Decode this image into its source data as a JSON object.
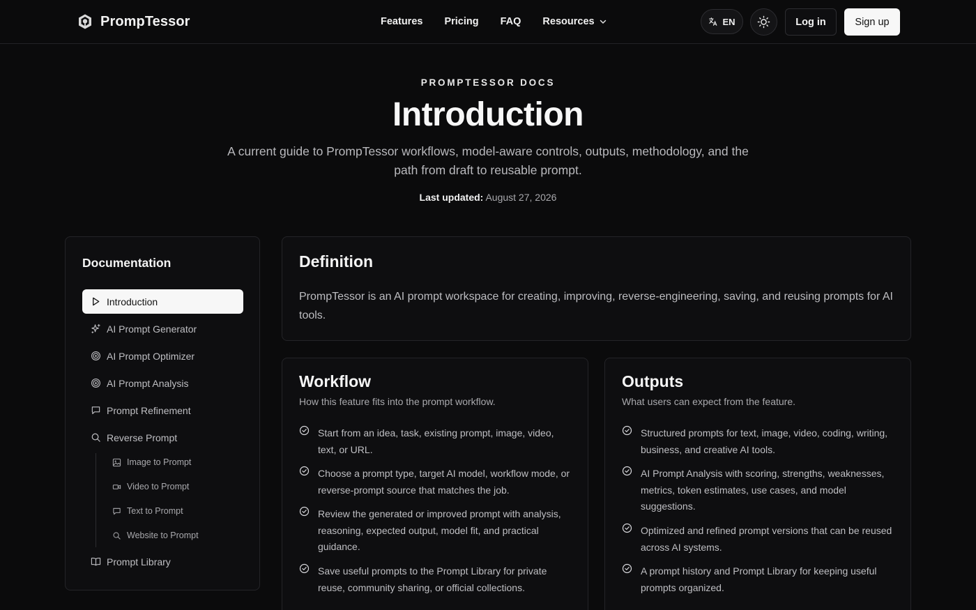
{
  "header": {
    "brand": "PrompTessor",
    "nav": [
      {
        "label": "Features"
      },
      {
        "label": "Pricing"
      },
      {
        "label": "FAQ"
      },
      {
        "label": "Resources"
      }
    ],
    "lang_label": "EN",
    "login_label": "Log in",
    "signup_label": "Sign up"
  },
  "hero": {
    "eyebrow": "PROMPTESSOR DOCS",
    "title": "Introduction",
    "subtitle": "A current guide to PrompTessor workflows, model-aware controls, outputs, methodology, and the path from draft to reusable prompt.",
    "updated_label": "Last updated:",
    "updated_date": "August 27, 2026"
  },
  "sidebar": {
    "title": "Documentation",
    "items": [
      {
        "label": "Introduction",
        "icon": "play-icon",
        "active": true
      },
      {
        "label": "AI Prompt Generator",
        "icon": "sparkles-icon"
      },
      {
        "label": "AI Prompt Optimizer",
        "icon": "target-icon"
      },
      {
        "label": "AI Prompt Analysis",
        "icon": "target-icon"
      },
      {
        "label": "Prompt Refinement",
        "icon": "message-square-icon"
      },
      {
        "label": "Reverse Prompt",
        "icon": "search-icon"
      }
    ],
    "subitems": [
      {
        "label": "Image to Prompt",
        "icon": "image-icon"
      },
      {
        "label": "Video to Prompt",
        "icon": "video-icon"
      },
      {
        "label": "Text to Prompt",
        "icon": "message-square-icon"
      },
      {
        "label": "Website to Prompt",
        "icon": "search-icon"
      }
    ],
    "library": {
      "label": "Prompt Library",
      "icon": "book-open-icon"
    }
  },
  "definition": {
    "title": "Definition",
    "body": "PrompTessor is an AI prompt workspace for creating, improving, reverse-engineering, saving, and reusing prompts for AI tools."
  },
  "workflow": {
    "title": "Workflow",
    "subtitle": "How this feature fits into the prompt workflow.",
    "items": [
      "Start from an idea, task, existing prompt, image, video, text, or URL.",
      "Choose a prompt type, target AI model, workflow mode, or reverse-prompt source that matches the job.",
      "Review the generated or improved prompt with analysis, reasoning, expected output, model fit, and practical guidance.",
      "Save useful prompts to the Prompt Library for private reuse, community sharing, or official collections."
    ]
  },
  "outputs": {
    "title": "Outputs",
    "subtitle": "What users can expect from the feature.",
    "items": [
      "Structured prompts for text, image, video, coding, writing, business, and creative AI tools.",
      "AI Prompt Analysis with scoring, strengths, weaknesses, metrics, token estimates, use cases, and model suggestions.",
      "Optimized and refined prompt versions that can be reused across AI systems.",
      "A prompt history and Prompt Library for keeping useful prompts organized."
    ]
  }
}
